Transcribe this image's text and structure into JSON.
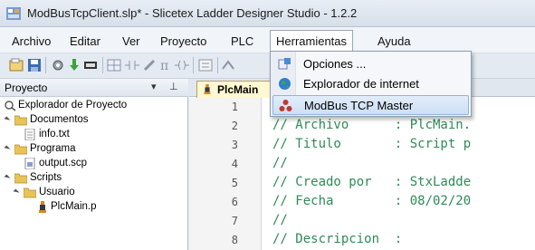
{
  "window": {
    "title": "ModBusTcpClient.slp* - Slicetex Ladder Designer Studio - 1.2.2",
    "app_icon": "ladder-app-icon"
  },
  "menubar": {
    "items": [
      {
        "label": "Archivo"
      },
      {
        "label": "Editar"
      },
      {
        "label": "Ver"
      },
      {
        "label": "Proyecto"
      },
      {
        "label": "PLC"
      },
      {
        "label": "Herramientas"
      },
      {
        "label": "Ayuda"
      }
    ],
    "open_menu": "Herramientas"
  },
  "toolbar": {
    "icons": [
      "new-project-icon",
      "save-icon",
      "settings-icon",
      "download-icon",
      "memory-icon",
      "grid-icon",
      "contact-icon",
      "edit-icon",
      "pi-icon",
      "coil-icon",
      "table-icon",
      "wire-icon"
    ]
  },
  "herramientas_menu": {
    "items": [
      {
        "label": "Opciones ...",
        "icon": "options-icon"
      },
      {
        "label": "Explorador de internet",
        "icon": "globe-icon"
      },
      {
        "label": "ModBus TCP Master",
        "icon": "modbus-icon",
        "highlighted": true
      }
    ]
  },
  "project_panel": {
    "title": "Proyecto",
    "dropdown_glyph": "▾",
    "pin_glyph": "⊥",
    "tree": [
      {
        "label": "Explorador de Proyecto",
        "icon": "explorer-icon",
        "level": 0
      },
      {
        "label": "Documentos",
        "icon": "folder-icon",
        "level": 1
      },
      {
        "label": "info.txt",
        "icon": "text-file-icon",
        "level": 2
      },
      {
        "label": "Programa",
        "icon": "folder-icon",
        "level": 1
      },
      {
        "label": "output.scp",
        "icon": "script-file-icon",
        "level": 2
      },
      {
        "label": "Scripts",
        "icon": "folder-icon",
        "level": 1
      },
      {
        "label": "Usuario",
        "icon": "folder-icon",
        "level": 2
      },
      {
        "label": "PlcMain.p",
        "icon": "plc-file-icon",
        "level": 3
      }
    ]
  },
  "editor": {
    "tab_label": "PlcMain",
    "lines": [
      {
        "no": "1",
        "text": "//------------------------"
      },
      {
        "no": "2",
        "text": "// Archivo      : PlcMain."
      },
      {
        "no": "3",
        "text": "// Titulo       : Script p"
      },
      {
        "no": "4",
        "text": "//"
      },
      {
        "no": "5",
        "text": "// Creado por   : StxLadde"
      },
      {
        "no": "6",
        "text": "// Fecha        : 08/02/20"
      },
      {
        "no": "7",
        "text": "//"
      },
      {
        "no": "8",
        "text": "// Descripcion  :"
      }
    ]
  },
  "colors": {
    "code_comment": "#2e8b57",
    "tab_active": "#fff8d2",
    "highlight_border": "#8fb3de",
    "folder": "#e8c35a"
  }
}
